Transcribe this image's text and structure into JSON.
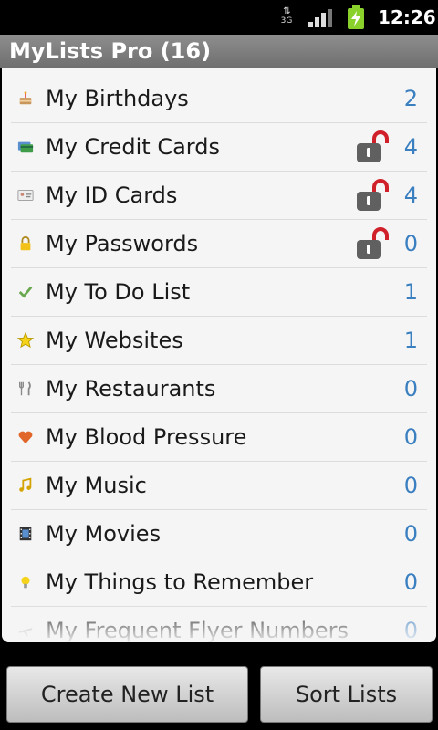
{
  "status_bar": {
    "network": "3G",
    "time": "12:26"
  },
  "title_bar": {
    "title": "MyLists Pro (16)"
  },
  "lists": [
    {
      "label": "My Birthdays",
      "count": "2",
      "icon": "cake-icon",
      "locked": false
    },
    {
      "label": "My Credit Cards",
      "count": "4",
      "icon": "credit-card-icon",
      "locked": true
    },
    {
      "label": "My ID Cards",
      "count": "4",
      "icon": "id-card-icon",
      "locked": true
    },
    {
      "label": "My Passwords",
      "count": "0",
      "icon": "padlock-icon",
      "locked": true
    },
    {
      "label": "My To Do List",
      "count": "1",
      "icon": "checkmark-icon",
      "locked": false
    },
    {
      "label": "My Websites",
      "count": "1",
      "icon": "star-icon",
      "locked": false
    },
    {
      "label": "My Restaurants",
      "count": "0",
      "icon": "fork-knife-icon",
      "locked": false
    },
    {
      "label": "My Blood Pressure",
      "count": "0",
      "icon": "heart-icon",
      "locked": false
    },
    {
      "label": "My Music",
      "count": "0",
      "icon": "music-note-icon",
      "locked": false
    },
    {
      "label": "My Movies",
      "count": "0",
      "icon": "film-icon",
      "locked": false
    },
    {
      "label": "My Things to Remember",
      "count": "0",
      "icon": "lightbulb-icon",
      "locked": false
    },
    {
      "label": "My Frequent Flyer Numbers",
      "count": "0",
      "icon": "airplane-icon",
      "locked": false
    }
  ],
  "buttons": {
    "create": "Create New List",
    "sort": "Sort Lists"
  },
  "colors": {
    "count": "#3a7fc0",
    "lock_shackle": "#d0202a",
    "lock_body": "#606060",
    "title_bar": "#7f7f7f"
  }
}
